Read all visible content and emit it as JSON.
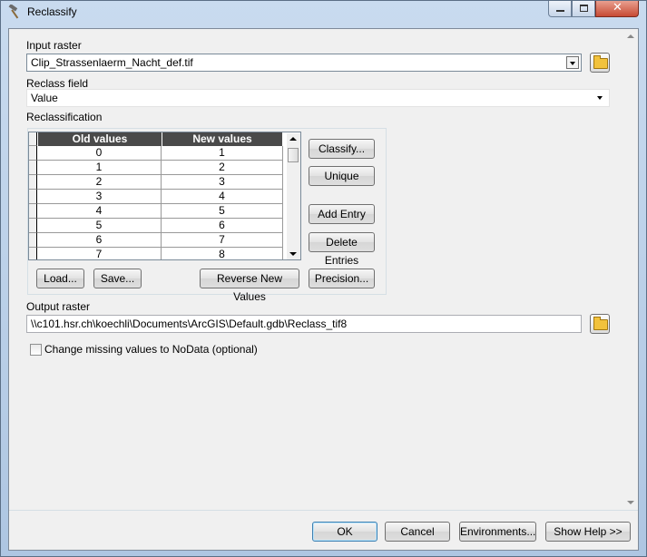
{
  "window": {
    "title": "Reclassify",
    "icon": "hammer-icon"
  },
  "input_raster": {
    "label": "Input raster",
    "value": "Clip_Strassenlaerm_Nacht_def.tif"
  },
  "reclass_field": {
    "label": "Reclass field",
    "value": "Value"
  },
  "reclassification": {
    "label": "Reclassification",
    "columns": [
      "Old values",
      "New values"
    ],
    "rows": [
      [
        "0",
        "1"
      ],
      [
        "1",
        "2"
      ],
      [
        "2",
        "3"
      ],
      [
        "3",
        "4"
      ],
      [
        "4",
        "5"
      ],
      [
        "5",
        "6"
      ],
      [
        "6",
        "7"
      ],
      [
        "7",
        "8"
      ]
    ],
    "buttons": {
      "classify": "Classify...",
      "unique": "Unique",
      "add_entry": "Add Entry",
      "delete_entries": "Delete Entries",
      "load": "Load...",
      "save": "Save...",
      "reverse": "Reverse New Values",
      "precision": "Precision..."
    }
  },
  "output_raster": {
    "label": "Output raster",
    "value": "\\\\c101.hsr.ch\\koechli\\Documents\\ArcGIS\\Default.gdb\\Reclass_tif8"
  },
  "nodata": {
    "label": "Change missing values to NoData (optional)",
    "checked": false
  },
  "footer": {
    "ok": "OK",
    "cancel": "Cancel",
    "environments": "Environments...",
    "show_help": "Show Help >>"
  }
}
